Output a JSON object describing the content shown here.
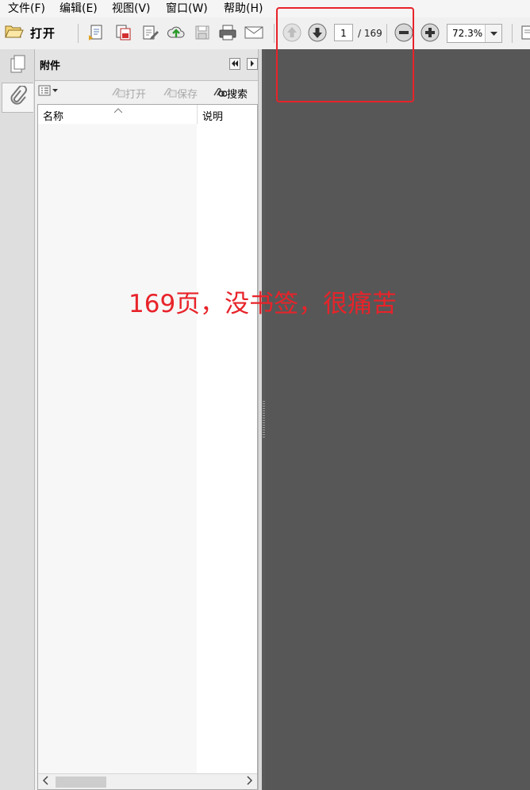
{
  "menu": [
    "文件(F)",
    "编辑(E)",
    "视图(V)",
    "窗口(W)",
    "帮助(H)"
  ],
  "toolbar": {
    "open_label": "打开",
    "current_page": "1",
    "page_total": "/ 169",
    "zoom": "72.3%"
  },
  "panel": {
    "title": "附件",
    "open_label": "打开",
    "save_label": "保存",
    "search_label": "搜索",
    "column_name": "名称",
    "column_description": "说明"
  },
  "annotation": {
    "text": "169页，没书签，很痛苦",
    "color": "#e8232a"
  },
  "colors": {
    "document_background": "#575757",
    "highlight": "#e8232a"
  }
}
